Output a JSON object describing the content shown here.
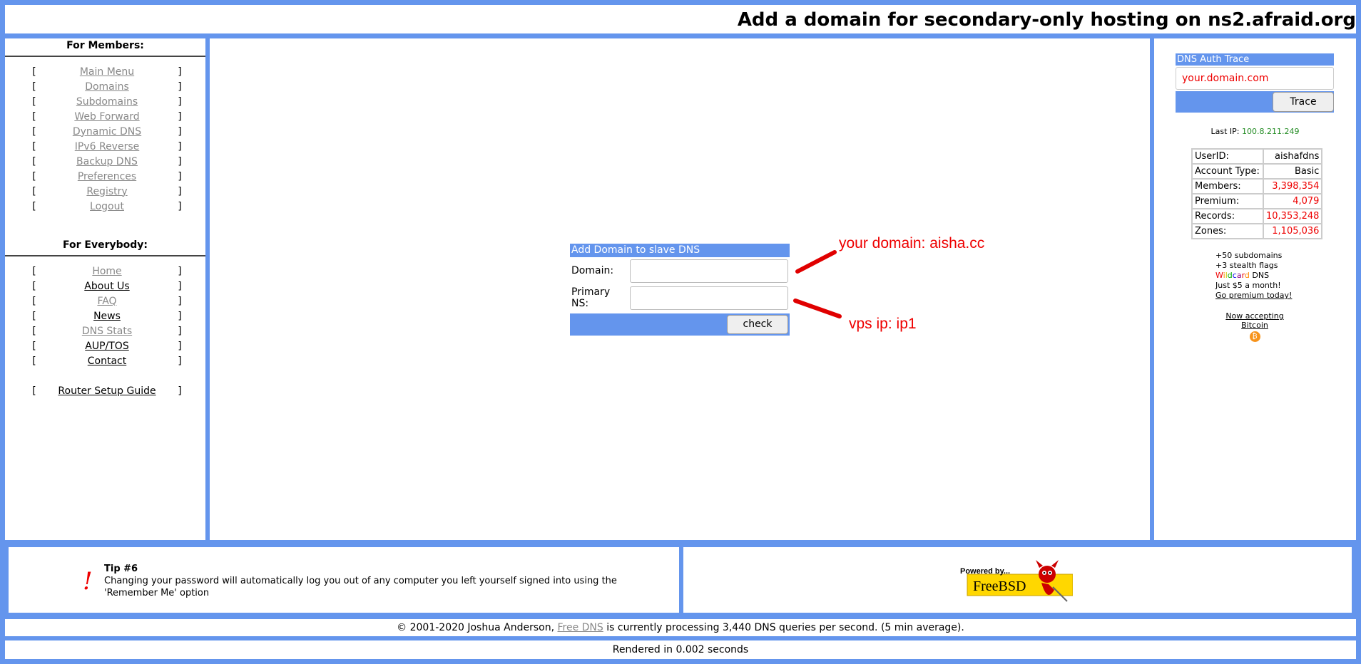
{
  "header": {
    "title": "Add a domain for secondary-only hosting on ns2.afraid.org"
  },
  "members": {
    "title": "For Members:",
    "items": [
      {
        "label": "Main Menu"
      },
      {
        "label": "Domains"
      },
      {
        "label": "Subdomains"
      },
      {
        "label": "Web Forward"
      },
      {
        "label": "Dynamic DNS"
      },
      {
        "label": "IPv6 Reverse"
      },
      {
        "label": "Backup DNS"
      },
      {
        "label": "Preferences"
      },
      {
        "label": "Registry"
      },
      {
        "label": "Logout"
      }
    ]
  },
  "everybody": {
    "title": "For Everybody:",
    "items": [
      {
        "label": "Home"
      },
      {
        "label": "About Us"
      },
      {
        "label": "FAQ"
      },
      {
        "label": "News"
      },
      {
        "label": "DNS Stats"
      },
      {
        "label": "AUP/TOS"
      },
      {
        "label": "Contact"
      }
    ],
    "router_guide": "Router Setup Guide"
  },
  "brackets": {
    "open": "[",
    "close": "]"
  },
  "form": {
    "heading": "Add Domain to slave DNS",
    "domain_label": "Domain:",
    "domain_value": "",
    "ns_label": "Primary NS:",
    "ns_value": "",
    "check_label": "check"
  },
  "annotations": {
    "domain_note": "your domain: aisha.cc",
    "ns_note": "vps ip: ip1",
    "color": "#e00000"
  },
  "trace": {
    "heading": "DNS Auth Trace",
    "input_value": "your.domain.com",
    "button_label": "Trace"
  },
  "last_ip": {
    "label": "Last IP:",
    "value": "100.8.211.249"
  },
  "stats": [
    {
      "key": "UserID:",
      "value": "aishafdns"
    },
    {
      "key": "Account Type:",
      "value": "Basic"
    },
    {
      "key": "Members:",
      "value": "3,398,354"
    },
    {
      "key": "Premium:",
      "value": "4,079"
    },
    {
      "key": "Records:",
      "value": "10,353,248"
    },
    {
      "key": "Zones:",
      "value": "1,105,036"
    }
  ],
  "promo": {
    "line1": "+50 subdomains",
    "line2": "+3 stealth flags",
    "wildcard_suffix": "DNS",
    "line4": "Just $5 a month!",
    "link": "Go premium today!",
    "bitcoin": "Now accepting Bitcoin"
  },
  "tip": {
    "title": "Tip #6",
    "icon": "!",
    "body": "Changing your password will automatically log you out of any computer you left yourself signed into using the 'Remember Me' option"
  },
  "freebsd": {
    "powered_by": "Powered by...",
    "brand": "FreeBSD"
  },
  "footer": {
    "copyright_prefix": "© 2001-2020 Joshua Anderson,",
    "link": "Free DNS",
    "copyright_suffix": "is currently processing 3,440 DNS queries per second. (5 min average).",
    "rendered": "Rendered in 0.002 seconds"
  },
  "colors": {
    "frame": "#6495ED",
    "accent_red": "#e00000",
    "ip_green": "#228B22"
  }
}
